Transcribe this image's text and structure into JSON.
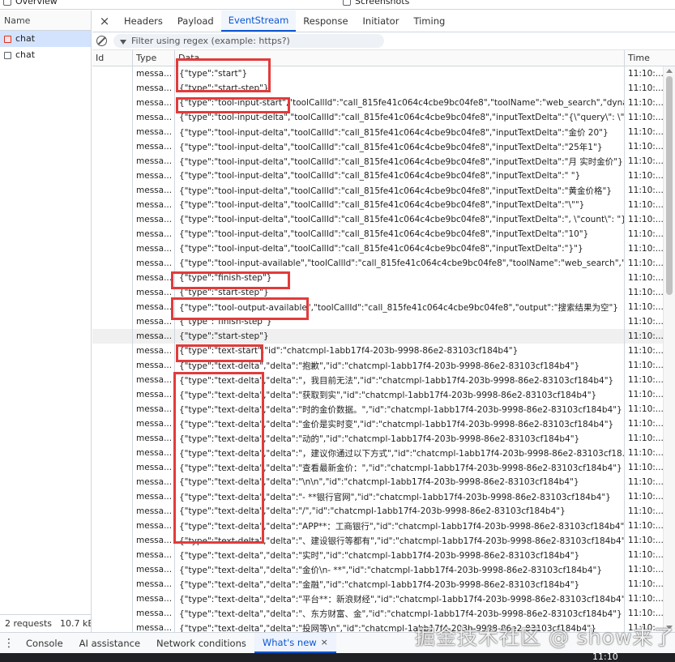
{
  "top_strip": {
    "overview_label": "Overview",
    "screenshots_label": "Screenshots"
  },
  "left_panel": {
    "header": "Name",
    "requests": [
      {
        "name": "chat",
        "selected": true,
        "icon": "fetch-error-icon"
      },
      {
        "name": "chat",
        "selected": false,
        "icon": "document-icon"
      }
    ],
    "status": {
      "requests": "2 requests",
      "size": "10.7 kB"
    }
  },
  "tabs": {
    "close": "×",
    "items": [
      "Headers",
      "Payload",
      "EventStream",
      "Response",
      "Initiator",
      "Timing"
    ],
    "active": "EventStream"
  },
  "filter": {
    "placeholder": "Filter using regex (example: https?)"
  },
  "grid": {
    "columns": {
      "id": "Id",
      "type": "Type",
      "data": "Data",
      "time": "Time"
    },
    "rows": [
      {
        "type": "messa...",
        "data": "{\"type\":\"start\"}",
        "time": "11:10:..."
      },
      {
        "type": "messa...",
        "data": "{\"type\":\"start-step\"}",
        "time": "11:10:..."
      },
      {
        "type": "messa...",
        "data": "{\"type\":\"tool-input-start\",\"toolCallId\":\"call_815fe41c064c4cbe9bc04fe8\",\"toolName\":\"web_search\",\"dyna...",
        "time": "11:10:..."
      },
      {
        "type": "messa...",
        "data": "{\"type\":\"tool-input-delta\",\"toolCallId\":\"call_815fe41c064c4cbe9bc04fe8\",\"inputTextDelta\":\"{\\\"query\\\": \\\"...",
        "time": "11:10:..."
      },
      {
        "type": "messa...",
        "data": "{\"type\":\"tool-input-delta\",\"toolCallId\":\"call_815fe41c064c4cbe9bc04fe8\",\"inputTextDelta\":\"金价 20\"}",
        "time": "11:10:..."
      },
      {
        "type": "messa...",
        "data": "{\"type\":\"tool-input-delta\",\"toolCallId\":\"call_815fe41c064c4cbe9bc04fe8\",\"inputTextDelta\":\"25年1\"}",
        "time": "11:10:..."
      },
      {
        "type": "messa...",
        "data": "{\"type\":\"tool-input-delta\",\"toolCallId\":\"call_815fe41c064c4cbe9bc04fe8\",\"inputTextDelta\":\"月 实时金价\"}",
        "time": "11:10:..."
      },
      {
        "type": "messa...",
        "data": "{\"type\":\"tool-input-delta\",\"toolCallId\":\"call_815fe41c064c4cbe9bc04fe8\",\"inputTextDelta\":\" \"}",
        "time": "11:10:..."
      },
      {
        "type": "messa...",
        "data": "{\"type\":\"tool-input-delta\",\"toolCallId\":\"call_815fe41c064c4cbe9bc04fe8\",\"inputTextDelta\":\"黄金价格\"}",
        "time": "11:10:..."
      },
      {
        "type": "messa...",
        "data": "{\"type\":\"tool-input-delta\",\"toolCallId\":\"call_815fe41c064c4cbe9bc04fe8\",\"inputTextDelta\":\"\\\"\"}",
        "time": "11:10:..."
      },
      {
        "type": "messa...",
        "data": "{\"type\":\"tool-input-delta\",\"toolCallId\":\"call_815fe41c064c4cbe9bc04fe8\",\"inputTextDelta\":\", \\\"count\\\": \"}",
        "time": "11:10:..."
      },
      {
        "type": "messa...",
        "data": "{\"type\":\"tool-input-delta\",\"toolCallId\":\"call_815fe41c064c4cbe9bc04fe8\",\"inputTextDelta\":\"10\"}",
        "time": "11:10:..."
      },
      {
        "type": "messa...",
        "data": "{\"type\":\"tool-input-delta\",\"toolCallId\":\"call_815fe41c064c4cbe9bc04fe8\",\"inputTextDelta\":\"}\"}",
        "time": "11:10:..."
      },
      {
        "type": "messa...",
        "data": "{\"type\":\"tool-input-available\",\"toolCallId\":\"call_815fe41c064c4cbe9bc04fe8\",\"toolName\":\"web_search\",\"i...",
        "time": "11:10:..."
      },
      {
        "type": "messa...",
        "data": "{\"type\":\"finish-step\"}",
        "time": "11:10:..."
      },
      {
        "type": "messa...",
        "data": "{\"type\":\"start-step\"}",
        "time": "11:10:..."
      },
      {
        "type": "messa...",
        "data": "{\"type\":\"tool-output-available\",\"toolCallId\":\"call_815fe41c064c4cbe9bc04fe8\",\"output\":\"搜索结果为空\"}",
        "time": "11:10:..."
      },
      {
        "type": "messa...",
        "data": "{\"type\":\"finish-step\"}",
        "time": "11:10:..."
      },
      {
        "type": "messa...",
        "data": "{\"type\":\"start-step\"}",
        "time": "11:10:...",
        "highlight": true
      },
      {
        "type": "messa...",
        "data": "{\"type\":\"text-start\",\"id\":\"chatcmpl-1abb17f4-203b-9998-86e2-83103cf184b4\"}",
        "time": "11:10:..."
      },
      {
        "type": "messa...",
        "data": "{\"type\":\"text-delta\",\"delta\":\"抱歉\",\"id\":\"chatcmpl-1abb17f4-203b-9998-86e2-83103cf184b4\"}",
        "time": "11:10:..."
      },
      {
        "type": "messa...",
        "data": "{\"type\":\"text-delta\",\"delta\":\"，我目前无法\",\"id\":\"chatcmpl-1abb17f4-203b-9998-86e2-83103cf184b4\"}",
        "time": "11:10:..."
      },
      {
        "type": "messa...",
        "data": "{\"type\":\"text-delta\",\"delta\":\"获取到实\",\"id\":\"chatcmpl-1abb17f4-203b-9998-86e2-83103cf184b4\"}",
        "time": "11:10:..."
      },
      {
        "type": "messa...",
        "data": "{\"type\":\"text-delta\",\"delta\":\"时的金价数据。\",\"id\":\"chatcmpl-1abb17f4-203b-9998-86e2-83103cf184b4\"}",
        "time": "11:10:..."
      },
      {
        "type": "messa...",
        "data": "{\"type\":\"text-delta\",\"delta\":\"金价是实时变\",\"id\":\"chatcmpl-1abb17f4-203b-9998-86e2-83103cf184b4\"}",
        "time": "11:10:..."
      },
      {
        "type": "messa...",
        "data": "{\"type\":\"text-delta\",\"delta\":\"动的\",\"id\":\"chatcmpl-1abb17f4-203b-9998-86e2-83103cf184b4\"}",
        "time": "11:10:..."
      },
      {
        "type": "messa...",
        "data": "{\"type\":\"text-delta\",\"delta\":\"，建议你通过以下方式\",\"id\":\"chatcmpl-1abb17f4-203b-9998-86e2-83103cf18...",
        "time": "11:10:..."
      },
      {
        "type": "messa...",
        "data": "{\"type\":\"text-delta\",\"delta\":\"查看最新金价：\",\"id\":\"chatcmpl-1abb17f4-203b-9998-86e2-83103cf184b4\"}",
        "time": "11:10:..."
      },
      {
        "type": "messa...",
        "data": "{\"type\":\"text-delta\",\"delta\":\"\\n\\n\",\"id\":\"chatcmpl-1abb17f4-203b-9998-86e2-83103cf184b4\"}",
        "time": "11:10:..."
      },
      {
        "type": "messa...",
        "data": "{\"type\":\"text-delta\",\"delta\":\"- **银行官网\",\"id\":\"chatcmpl-1abb17f4-203b-9998-86e2-83103cf184b4\"}",
        "time": "11:10:..."
      },
      {
        "type": "messa...",
        "data": "{\"type\":\"text-delta\",\"delta\":\"/\",\"id\":\"chatcmpl-1abb17f4-203b-9998-86e2-83103cf184b4\"}",
        "time": "11:10:..."
      },
      {
        "type": "messa...",
        "data": "{\"type\":\"text-delta\",\"delta\":\"APP**：工商银行\",\"id\":\"chatcmpl-1abb17f4-203b-9998-86e2-83103cf184b4\"}",
        "time": "11:10:..."
      },
      {
        "type": "messa...",
        "data": "{\"type\":\"text-delta\",\"delta\":\"、建设银行等都有\",\"id\":\"chatcmpl-1abb17f4-203b-9998-86e2-83103cf184b4\"}",
        "time": "11:10:..."
      },
      {
        "type": "messa...",
        "data": "{\"type\":\"text-delta\",\"delta\":\"实时\",\"id\":\"chatcmpl-1abb17f4-203b-9998-86e2-83103cf184b4\"}",
        "time": "11:10:..."
      },
      {
        "type": "messa...",
        "data": "{\"type\":\"text-delta\",\"delta\":\"金价\\n- **\",\"id\":\"chatcmpl-1abb17f4-203b-9998-86e2-83103cf184b4\"}",
        "time": "11:10:..."
      },
      {
        "type": "messa...",
        "data": "{\"type\":\"text-delta\",\"delta\":\"金融\",\"id\":\"chatcmpl-1abb17f4-203b-9998-86e2-83103cf184b4\"}",
        "time": "11:10:..."
      },
      {
        "type": "messa...",
        "data": "{\"type\":\"text-delta\",\"delta\":\"平台**：新浪财经\",\"id\":\"chatcmpl-1abb17f4-203b-9998-86e2-83103cf184b4\"}",
        "time": "11:10:..."
      },
      {
        "type": "messa...",
        "data": "{\"type\":\"text-delta\",\"delta\":\"、东方财富、金\",\"id\":\"chatcmpl-1abb17f4-203b-9998-86e2-83103cf184b4\"}",
        "time": "11:10:..."
      },
      {
        "type": "messa...",
        "data": "{\"type\":\"text-delta\",\"delta\":\"投网等\\n\",\"id\":\"chatcmpl-1abb17f4-203b-9998-86e2-83103cf184b4\"}",
        "time": "11:10:..."
      }
    ]
  },
  "drawer": {
    "tabs": [
      "Console",
      "AI assistance",
      "Network conditions",
      "What's new"
    ],
    "active": "What's new",
    "close": "×"
  },
  "bottom_strip_text": "11:10",
  "watermark": "掘金技术社区 @ show来了",
  "colors": {
    "accent": "#0b57d0",
    "annotation": "#e23b3b"
  }
}
